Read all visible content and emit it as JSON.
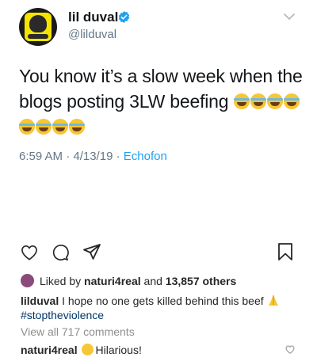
{
  "tweet": {
    "display_name": "lil duval",
    "handle": "@lilduval",
    "text_line1": "You know it’s a slow week when the",
    "text_line2": "blogs posting 3LW beefing",
    "timestamp": "6:59 AM · 4/13/19 · ",
    "source": "Echofon",
    "emoji": "face-with-tears-of-joy"
  },
  "post": {
    "liked_prefix": "Liked by ",
    "liked_user": "naturi4real",
    "liked_and": " and ",
    "liked_count": "13,857 others",
    "caption_user": "lilduval",
    "caption_text": " I hope no one gets killed behind this beef ",
    "hashtag": "#stoptheviolence",
    "view_all": "View all 717 comments",
    "comment_user": "naturi4real",
    "comment_text": "Hilarious!"
  },
  "colors": {
    "verified": "#1da1f2",
    "link": "#1da1f2",
    "hashtag": "#003569"
  }
}
